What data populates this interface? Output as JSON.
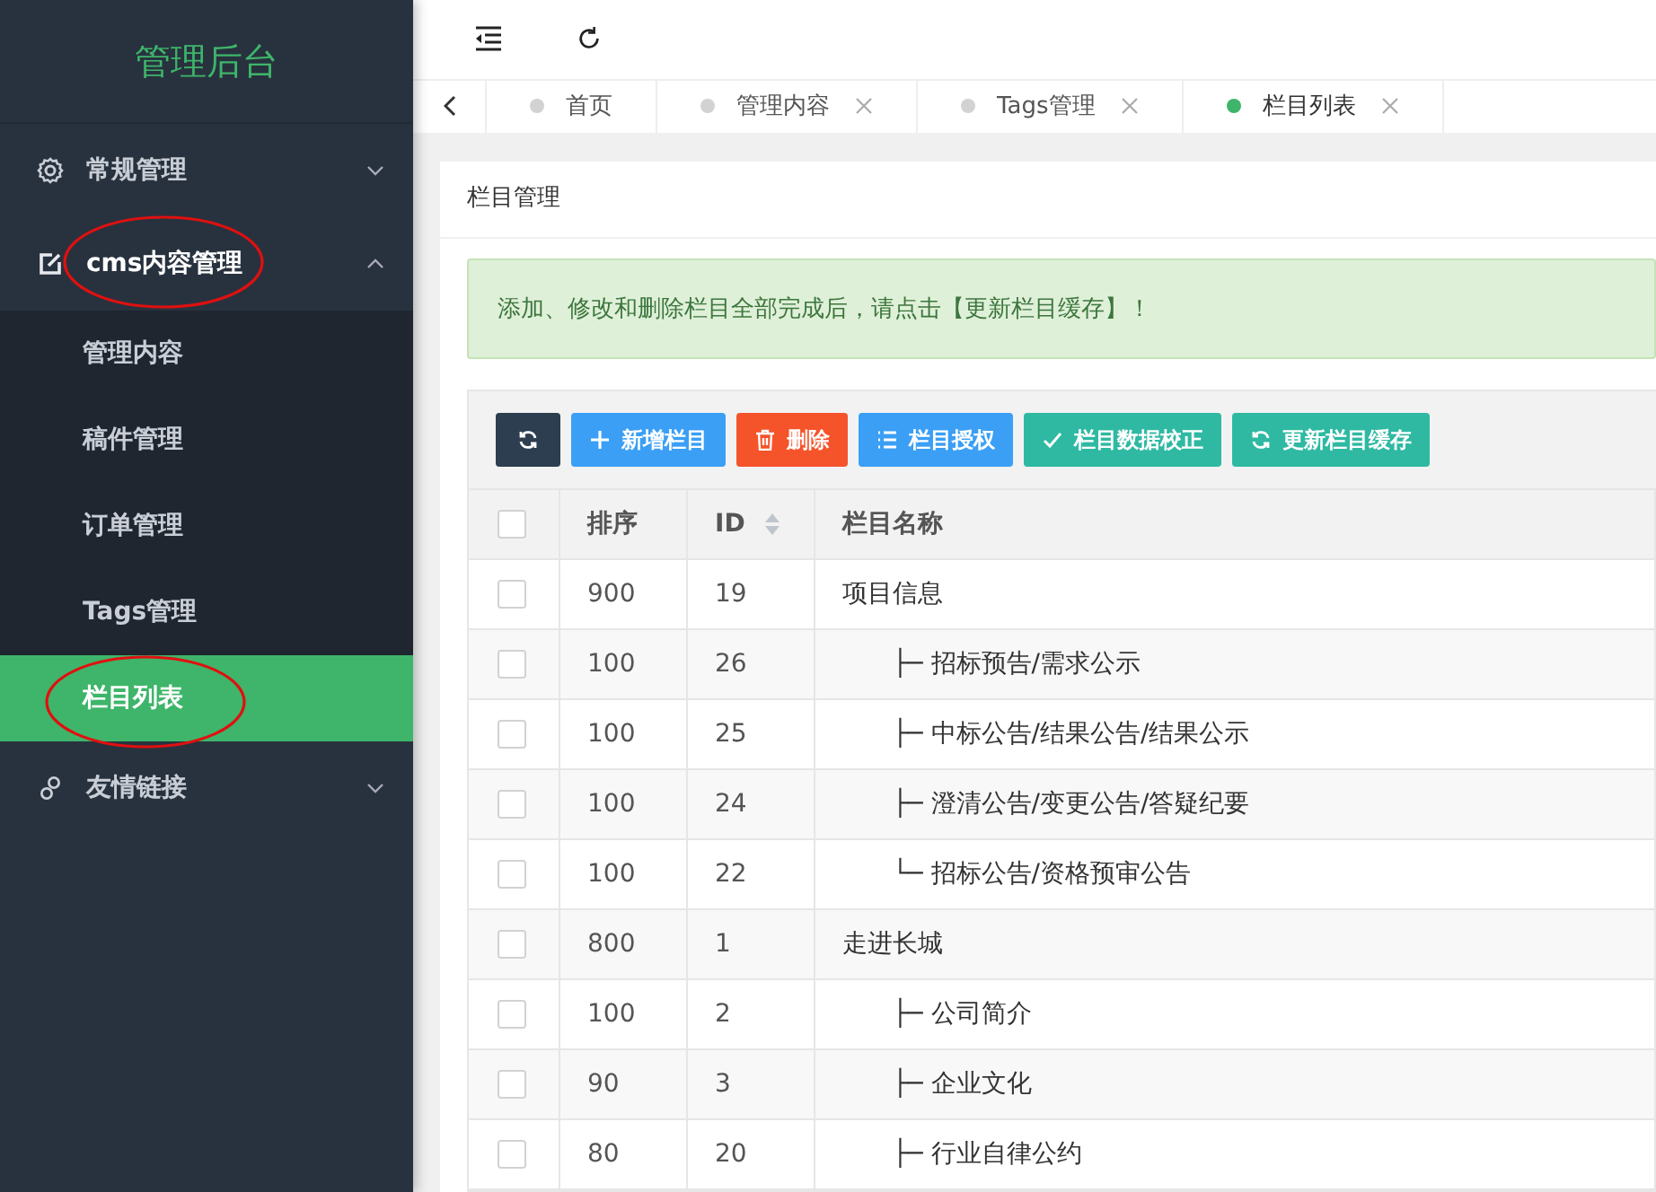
{
  "sidebar": {
    "title": "管理后台",
    "items": [
      {
        "label": "常规管理",
        "kind": "settings",
        "expanded": false,
        "circled": false
      },
      {
        "label": "cms内容管理",
        "kind": "content",
        "expanded": true,
        "circled": true,
        "children": [
          {
            "label": "管理内容",
            "selected": false,
            "circled": false
          },
          {
            "label": "稿件管理",
            "selected": false,
            "circled": false
          },
          {
            "label": "订单管理",
            "selected": false,
            "circled": false
          },
          {
            "label": "Tags管理",
            "selected": false,
            "circled": false
          },
          {
            "label": "栏目列表",
            "selected": true,
            "circled": true
          }
        ]
      },
      {
        "label": "友情链接",
        "kind": "links",
        "expanded": false,
        "circled": false
      }
    ]
  },
  "tabs": [
    {
      "label": "首页",
      "selected": false,
      "closable": false
    },
    {
      "label": "管理内容",
      "selected": false,
      "closable": true
    },
    {
      "label": "Tags管理",
      "selected": false,
      "closable": true
    },
    {
      "label": "栏目列表",
      "selected": true,
      "closable": true
    }
  ],
  "panel": {
    "title": "栏目管理",
    "notice": "添加、修改和删除栏目全部完成后，请点击【更新栏目缓存】！",
    "buttons": [
      {
        "kind": "refresh"
      },
      {
        "kind": "add",
        "label": "新增栏目"
      },
      {
        "kind": "delete",
        "label": "删除"
      },
      {
        "kind": "auth",
        "label": "栏目授权"
      },
      {
        "kind": "check",
        "label": "栏目数据校正"
      },
      {
        "kind": "cache",
        "label": "更新栏目缓存"
      }
    ],
    "table": {
      "select_all_checked": false,
      "columns": [
        "排序",
        "ID",
        "栏目名称"
      ],
      "rows": [
        {
          "sort": "900",
          "id": "19",
          "name": "项目信息",
          "checked": false,
          "children": [
            {
              "sort": "100",
              "id": "26",
              "name": "├─ 招标预告/需求公示",
              "checked": false
            },
            {
              "sort": "100",
              "id": "25",
              "name": "├─ 中标公告/结果公告/结果公示",
              "checked": false
            },
            {
              "sort": "100",
              "id": "24",
              "name": "├─ 澄清公告/变更公告/答疑纪要",
              "checked": false
            },
            {
              "sort": "100",
              "id": "22",
              "name": "└─ 招标公告/资格预审公告",
              "checked": false
            }
          ]
        },
        {
          "sort": "800",
          "id": "1",
          "name": "走进长城",
          "checked": false,
          "children": [
            {
              "sort": "100",
              "id": "2",
              "name": "├─ 公司简介",
              "checked": false
            },
            {
              "sort": "90",
              "id": "3",
              "name": "├─ 企业文化",
              "checked": false
            },
            {
              "sort": "80",
              "id": "20",
              "name": "├─ 行业自律公约",
              "checked": false
            }
          ]
        }
      ]
    }
  }
}
